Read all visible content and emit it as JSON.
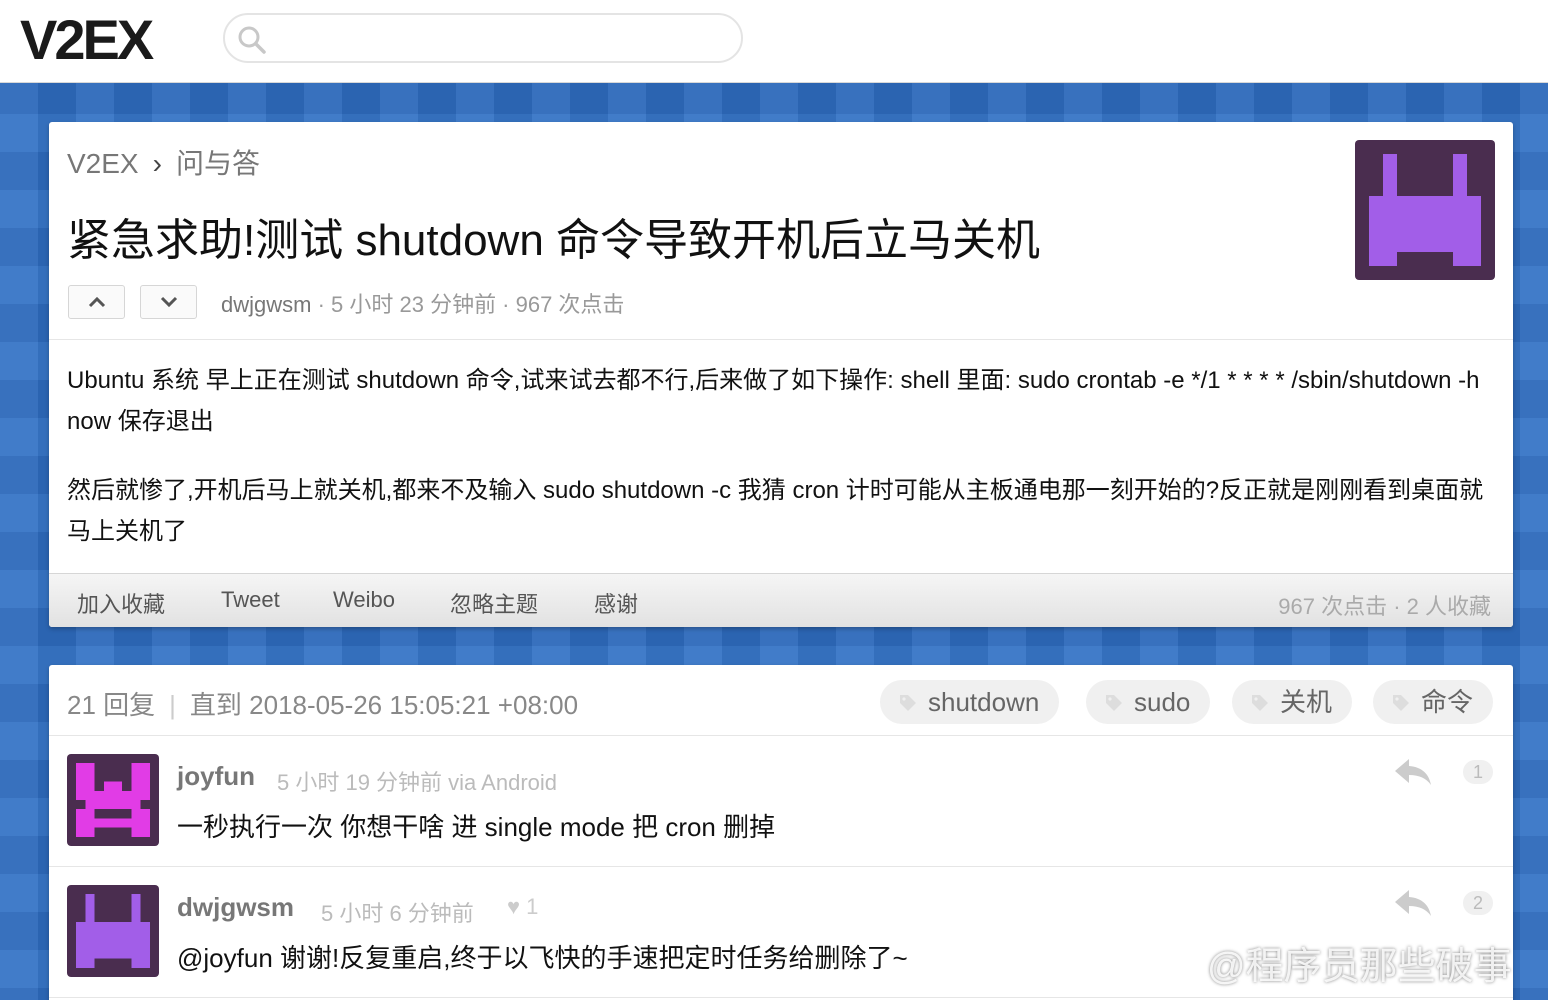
{
  "site": {
    "logo": "V2EX",
    "search_placeholder": ""
  },
  "topic": {
    "breadcrumb": {
      "home": "V2EX",
      "separator": "›",
      "node": "问与答"
    },
    "title": "紧急求助!测试 shutdown 命令导致开机后立马关机",
    "author": "dwjgwsm",
    "meta_rest": " · 5 小时 23 分钟前 · 967 次点击",
    "content": [
      "Ubuntu 系统 早上正在测试 shutdown 命令,试来试去都不行,后来做了如下操作: shell 里面: sudo crontab -e */1 * * * * /sbin/shutdown -h now 保存退出",
      "然后就惨了,开机后马上就关机,都来不及输入 sudo shutdown -c 我猜 cron 计时可能从主板通电那一刻开始的?反正就是刚刚看到桌面就马上关机了"
    ],
    "actions": [
      "加入收藏",
      "Tweet",
      "Weibo",
      "忽略主题",
      "感谢"
    ],
    "stats": "967 次点击 · 2 人收藏"
  },
  "replies_header": {
    "count": "21 回复",
    "separator": "|",
    "until": "直到 2018-05-26 15:05:21 +08:00",
    "tags": [
      "shutdown",
      "sudo",
      "关机",
      "命令"
    ]
  },
  "replies": [
    {
      "name": "joyfun",
      "time": "5 小时 19 分钟前 via Android",
      "text": "一秒执行一次 你想干啥 进 single mode 把 cron 删掉",
      "floor": "1",
      "likes": ""
    },
    {
      "name": "dwjgwsm",
      "time": "5 小时 6 分钟前",
      "text": "@joyfun 谢谢!反复重启,终于以飞快的手速把定时任务给删除了~",
      "floor": "2",
      "likes": "1"
    }
  ],
  "watermark": "@程序员那些破事",
  "colors": {
    "background": "#2f6fc4",
    "avatar_purple": "#a25ee8",
    "avatar_magenta": "#e13ce6",
    "avatar_dark": "#4a2d4f"
  }
}
